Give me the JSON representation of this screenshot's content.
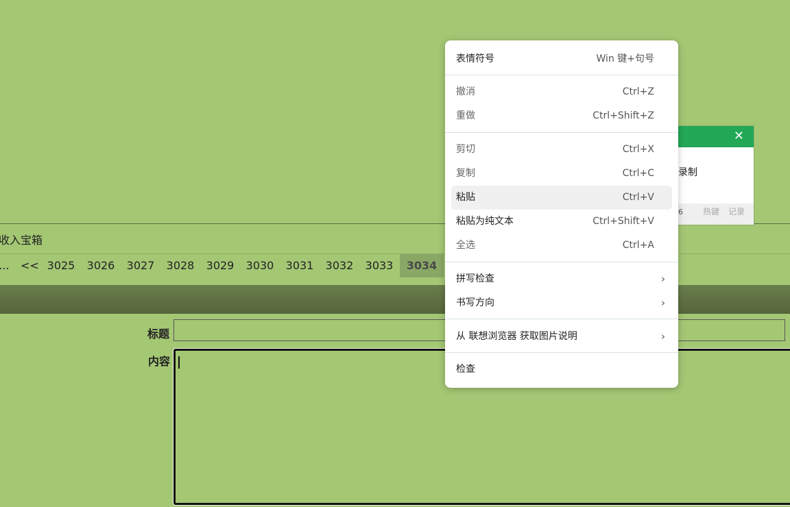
{
  "page": {
    "shoucang_text": "收入宝箱",
    "labels": {
      "title": "标题",
      "content": "内容"
    }
  },
  "pager": {
    "items": [
      "...",
      "<<",
      "3025",
      "3026",
      "3027",
      "3028",
      "3029",
      "3030",
      "3031",
      "3032",
      "3033",
      "3034"
    ],
    "current": "3034"
  },
  "popup": {
    "close_glyph": "✕",
    "body_text": "录制",
    "footer_num": "6",
    "hotkey": "热键",
    "record": "记录"
  },
  "menu": {
    "emoji": {
      "label": "表情符号",
      "shortcut": "Win 键+句号"
    },
    "undo": {
      "label": "撤消",
      "shortcut": "Ctrl+Z"
    },
    "redo": {
      "label": "重做",
      "shortcut": "Ctrl+Shift+Z"
    },
    "cut": {
      "label": "剪切",
      "shortcut": "Ctrl+X"
    },
    "copy": {
      "label": "复制",
      "shortcut": "Ctrl+C"
    },
    "paste": {
      "label": "粘贴",
      "shortcut": "Ctrl+V"
    },
    "paste_plain": {
      "label": "粘贴为纯文本",
      "shortcut": "Ctrl+Shift+V"
    },
    "select_all": {
      "label": "全选",
      "shortcut": "Ctrl+A"
    },
    "spellcheck": {
      "label": "拼写检查",
      "arrow": "›"
    },
    "writing_direction": {
      "label": "书写方向",
      "arrow": "›"
    },
    "image_desc": {
      "label": "从 联想浏览器 获取图片说明",
      "arrow": "›"
    },
    "inspect": {
      "label": "检查"
    }
  },
  "colors": {
    "page_bg": "#a4c774",
    "popup_header": "#22a857",
    "menu_hover": "#f0f0f0"
  }
}
